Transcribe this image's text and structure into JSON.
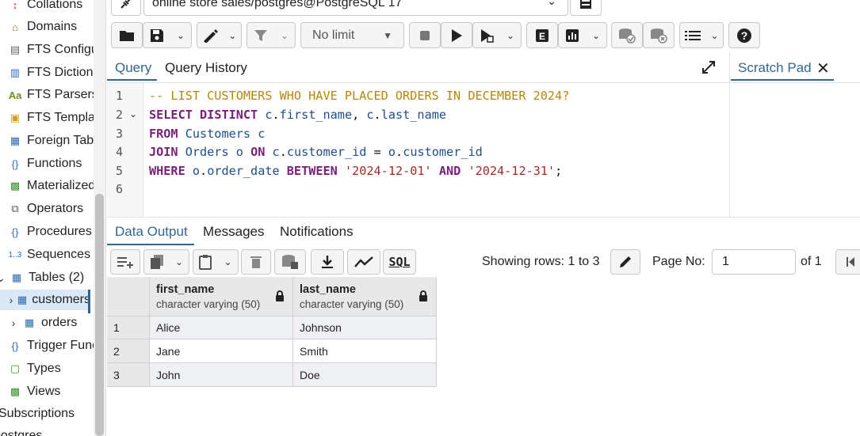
{
  "tree": {
    "items": [
      {
        "label": "Collations",
        "icon": "collation-icon"
      },
      {
        "label": "Domains",
        "icon": "domain-icon"
      },
      {
        "label": "FTS Configurations",
        "icon": "fts-config-icon"
      },
      {
        "label": "FTS Dictionaries",
        "icon": "fts-dictionary-icon"
      },
      {
        "label": "FTS Parsers",
        "icon": "fts-parser-icon"
      },
      {
        "label": "FTS Templates",
        "icon": "fts-template-icon"
      },
      {
        "label": "Foreign Tables",
        "icon": "foreign-table-icon"
      },
      {
        "label": "Functions",
        "icon": "function-icon"
      },
      {
        "label": "Materialized Views",
        "icon": "materialized-view-icon"
      },
      {
        "label": "Operators",
        "icon": "operator-icon"
      },
      {
        "label": "Procedures",
        "icon": "procedure-icon"
      },
      {
        "label": "Sequences",
        "icon": "sequence-icon"
      },
      {
        "label": "Tables (2)",
        "icon": "table-icon"
      },
      {
        "label": "customers",
        "icon": "table-icon"
      },
      {
        "label": "orders",
        "icon": "table-icon"
      },
      {
        "label": "Trigger Functions",
        "icon": "trigger-function-icon"
      },
      {
        "label": "Types",
        "icon": "type-icon"
      },
      {
        "label": "Views",
        "icon": "view-icon"
      },
      {
        "label": "Subscriptions",
        "icon": ""
      },
      {
        "label": "postgres",
        "icon": ""
      }
    ]
  },
  "connection": {
    "label": "online store sales/postgres@PostgreSQL 17"
  },
  "toolbar": {
    "limit_label": "No limit"
  },
  "query_tabs": {
    "query": "Query",
    "history": "Query History",
    "scratch": "Scratch Pad"
  },
  "editor": {
    "lines": [
      "1",
      "2",
      "3",
      "4",
      "5",
      "6"
    ],
    "code": [
      "-- LIST CUSTOMERS WHO HAVE PLACED ORDERS IN DECEMBER 2024?",
      "SELECT DISTINCT c.first_name, c.last_name",
      "FROM Customers c",
      "JOIN Orders o ON c.customer_id = o.customer_id",
      "WHERE o.order_date BETWEEN '2024-12-01' AND '2024-12-31';"
    ]
  },
  "output_tabs": {
    "data": "Data Output",
    "messages": "Messages",
    "notifications": "Notifications"
  },
  "result_toolbar": {
    "sql_label": "SQL",
    "showing": "Showing rows: 1 to 3",
    "page_label": "Page No:",
    "page_value": "1",
    "of": "of 1"
  },
  "grid": {
    "columns": [
      {
        "name": "first_name",
        "type": "character varying (50)"
      },
      {
        "name": "last_name",
        "type": "character varying (50)"
      }
    ],
    "rows": [
      {
        "num": "1",
        "first_name": "Alice",
        "last_name": "Johnson"
      },
      {
        "num": "2",
        "first_name": "Jane",
        "last_name": "Smith"
      },
      {
        "num": "3",
        "first_name": "John",
        "last_name": "Doe"
      }
    ]
  },
  "colors": {
    "accent": "#326690",
    "keyword": "#7a1f7a",
    "comment": "#b8860b",
    "string": "#a52a2a"
  }
}
